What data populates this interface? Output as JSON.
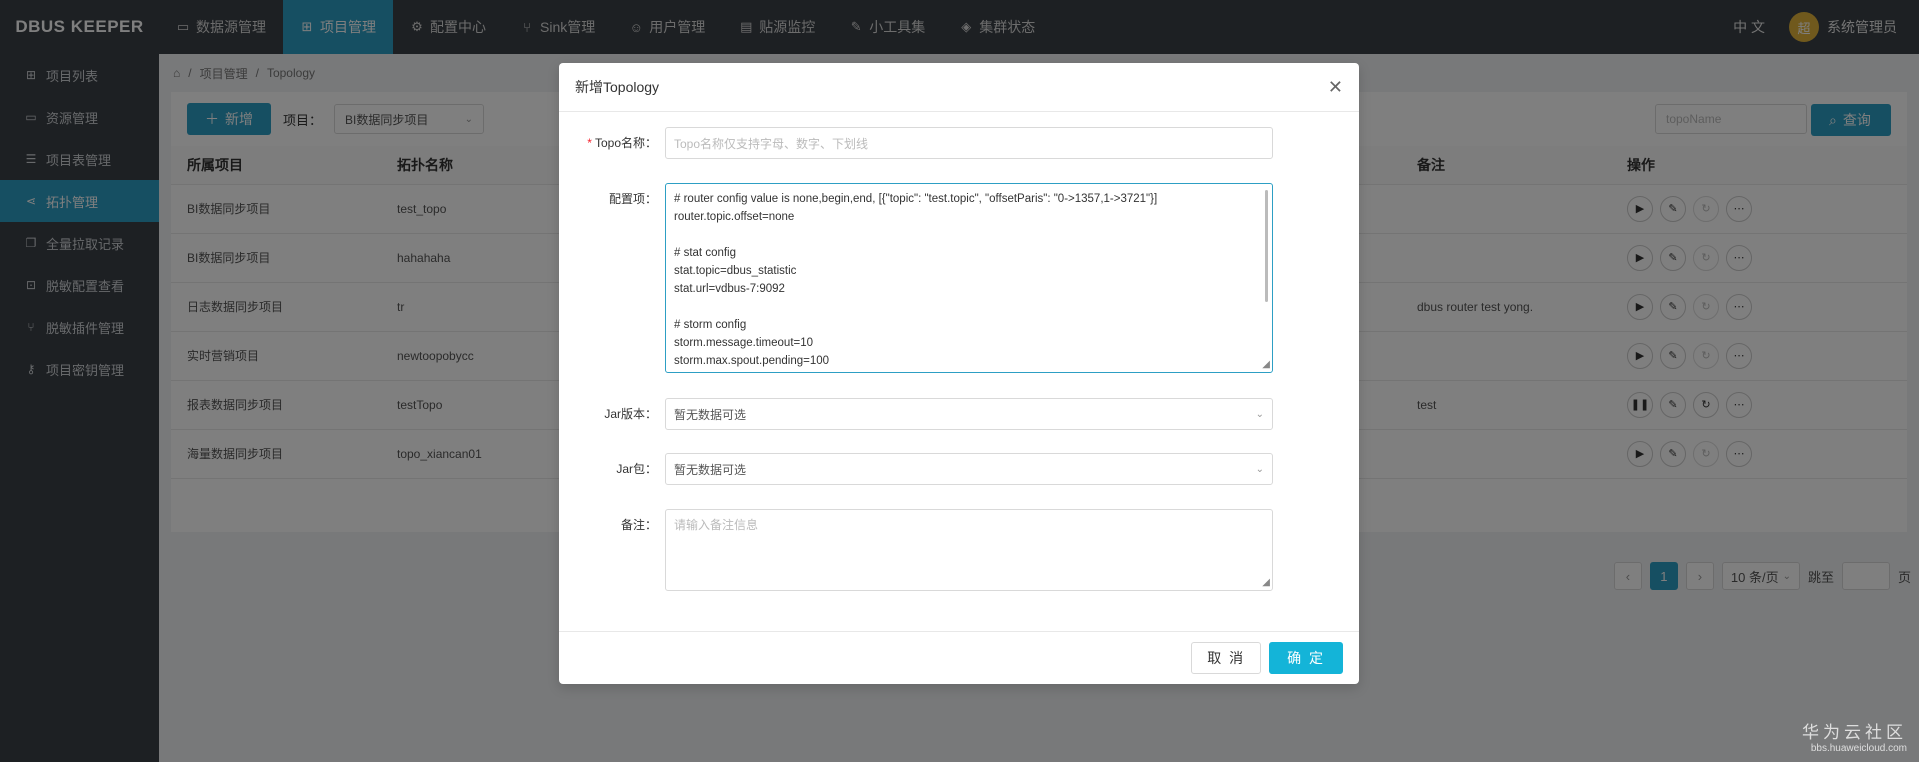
{
  "app": {
    "logo": "DBUS KEEPER"
  },
  "nav": {
    "items": [
      {
        "icon": "monitor-icon",
        "label": "数据源管理"
      },
      {
        "icon": "grid-icon",
        "label": "项目管理"
      },
      {
        "icon": "gear-icon",
        "label": "配置中心"
      },
      {
        "icon": "branch-icon",
        "label": "Sink管理"
      },
      {
        "icon": "user-icon",
        "label": "用户管理"
      },
      {
        "icon": "chart-icon",
        "label": "贴源监控"
      },
      {
        "icon": "wrench-icon",
        "label": "小工具集"
      },
      {
        "icon": "shield-icon",
        "label": "集群状态"
      }
    ],
    "lang": "中 文",
    "user_initial": "超",
    "user_name": "系统管理员"
  },
  "sidebar": {
    "items": [
      {
        "label": "项目列表"
      },
      {
        "label": "资源管理"
      },
      {
        "label": "项目表管理"
      },
      {
        "label": "拓扑管理"
      },
      {
        "label": "全量拉取记录"
      },
      {
        "label": "脱敏配置查看"
      },
      {
        "label": "脱敏插件管理"
      },
      {
        "label": "项目密钥管理"
      }
    ]
  },
  "breadcrumb": {
    "level1": "项目管理",
    "level2": "Topology"
  },
  "toolbar": {
    "add_label": "新增",
    "project_label": "项目：",
    "project_value": "BI数据同步项目",
    "search_placeholder": "topoName",
    "search_label": "查询"
  },
  "table": {
    "headers": [
      "所属项目",
      "拓扑名称",
      "备注",
      "操作"
    ],
    "rows": [
      {
        "project": "BI数据同步项目",
        "topo": "test_topo",
        "remark": ""
      },
      {
        "project": "BI数据同步项目",
        "topo": "hahahaha",
        "remark": ""
      },
      {
        "project": "日志数据同步项目",
        "topo": "tr",
        "remark": "dbus router test yong."
      },
      {
        "project": "实时营销项目",
        "topo": "newtoopobycc",
        "remark": ""
      },
      {
        "project": "报表数据同步项目",
        "topo": "testTopo",
        "remark": "test"
      },
      {
        "project": "海量数据同步项目",
        "topo": "topo_xiancan01",
        "remark": ""
      }
    ]
  },
  "pager": {
    "current": "1",
    "page_size": "10 条/页",
    "goto": "跳至",
    "page_unit": "页"
  },
  "modal": {
    "title": "新增Topology",
    "topo_label": "Topo名称：",
    "topo_placeholder": "Topo名称仅支持字母、数字、下划线",
    "config_label": "配置项：",
    "config_lines": [
      "# router config value is none,begin,end, [{\"topic\": \"test.topic\", \"offsetParis\": \"0->1357,1->3721\"}]",
      "router.topic.offset=none",
      "",
      "# stat config",
      "stat.topic=dbus_statistic",
      "stat.url=vdbus-7:9092",
      "",
      "# storm config",
      "storm.message.timeout=10",
      "storm.max.spout.pending=100"
    ],
    "jar_version_label": "Jar版本：",
    "jar_version_value": "暂无数据可选",
    "jar_pkg_label": "Jar包：",
    "jar_pkg_value": "暂无数据可选",
    "remark_label": "备注：",
    "remark_placeholder": "请输入备注信息",
    "cancel": "取 消",
    "ok": "确 定"
  },
  "watermark": {
    "line1": "华为云社区",
    "line2": "bbs.huaweicloud.com"
  }
}
